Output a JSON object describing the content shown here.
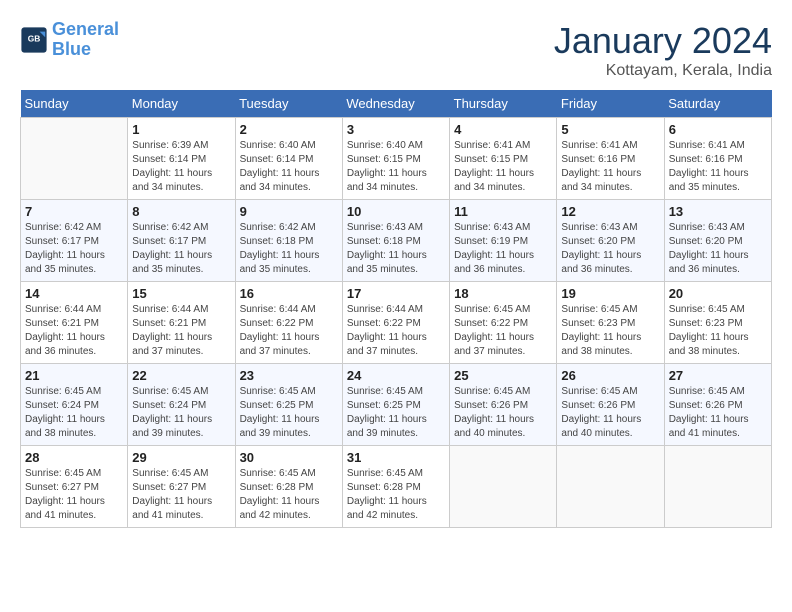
{
  "header": {
    "logo_line1": "General",
    "logo_line2": "Blue",
    "month": "January 2024",
    "location": "Kottayam, Kerala, India"
  },
  "weekdays": [
    "Sunday",
    "Monday",
    "Tuesday",
    "Wednesday",
    "Thursday",
    "Friday",
    "Saturday"
  ],
  "weeks": [
    [
      {
        "day": "",
        "sunrise": "",
        "sunset": "",
        "daylight": ""
      },
      {
        "day": "1",
        "sunrise": "Sunrise: 6:39 AM",
        "sunset": "Sunset: 6:14 PM",
        "daylight": "Daylight: 11 hours and 34 minutes."
      },
      {
        "day": "2",
        "sunrise": "Sunrise: 6:40 AM",
        "sunset": "Sunset: 6:14 PM",
        "daylight": "Daylight: 11 hours and 34 minutes."
      },
      {
        "day": "3",
        "sunrise": "Sunrise: 6:40 AM",
        "sunset": "Sunset: 6:15 PM",
        "daylight": "Daylight: 11 hours and 34 minutes."
      },
      {
        "day": "4",
        "sunrise": "Sunrise: 6:41 AM",
        "sunset": "Sunset: 6:15 PM",
        "daylight": "Daylight: 11 hours and 34 minutes."
      },
      {
        "day": "5",
        "sunrise": "Sunrise: 6:41 AM",
        "sunset": "Sunset: 6:16 PM",
        "daylight": "Daylight: 11 hours and 34 minutes."
      },
      {
        "day": "6",
        "sunrise": "Sunrise: 6:41 AM",
        "sunset": "Sunset: 6:16 PM",
        "daylight": "Daylight: 11 hours and 35 minutes."
      }
    ],
    [
      {
        "day": "7",
        "sunrise": "Sunrise: 6:42 AM",
        "sunset": "Sunset: 6:17 PM",
        "daylight": "Daylight: 11 hours and 35 minutes."
      },
      {
        "day": "8",
        "sunrise": "Sunrise: 6:42 AM",
        "sunset": "Sunset: 6:17 PM",
        "daylight": "Daylight: 11 hours and 35 minutes."
      },
      {
        "day": "9",
        "sunrise": "Sunrise: 6:42 AM",
        "sunset": "Sunset: 6:18 PM",
        "daylight": "Daylight: 11 hours and 35 minutes."
      },
      {
        "day": "10",
        "sunrise": "Sunrise: 6:43 AM",
        "sunset": "Sunset: 6:18 PM",
        "daylight": "Daylight: 11 hours and 35 minutes."
      },
      {
        "day": "11",
        "sunrise": "Sunrise: 6:43 AM",
        "sunset": "Sunset: 6:19 PM",
        "daylight": "Daylight: 11 hours and 36 minutes."
      },
      {
        "day": "12",
        "sunrise": "Sunrise: 6:43 AM",
        "sunset": "Sunset: 6:20 PM",
        "daylight": "Daylight: 11 hours and 36 minutes."
      },
      {
        "day": "13",
        "sunrise": "Sunrise: 6:43 AM",
        "sunset": "Sunset: 6:20 PM",
        "daylight": "Daylight: 11 hours and 36 minutes."
      }
    ],
    [
      {
        "day": "14",
        "sunrise": "Sunrise: 6:44 AM",
        "sunset": "Sunset: 6:21 PM",
        "daylight": "Daylight: 11 hours and 36 minutes."
      },
      {
        "day": "15",
        "sunrise": "Sunrise: 6:44 AM",
        "sunset": "Sunset: 6:21 PM",
        "daylight": "Daylight: 11 hours and 37 minutes."
      },
      {
        "day": "16",
        "sunrise": "Sunrise: 6:44 AM",
        "sunset": "Sunset: 6:22 PM",
        "daylight": "Daylight: 11 hours and 37 minutes."
      },
      {
        "day": "17",
        "sunrise": "Sunrise: 6:44 AM",
        "sunset": "Sunset: 6:22 PM",
        "daylight": "Daylight: 11 hours and 37 minutes."
      },
      {
        "day": "18",
        "sunrise": "Sunrise: 6:45 AM",
        "sunset": "Sunset: 6:22 PM",
        "daylight": "Daylight: 11 hours and 37 minutes."
      },
      {
        "day": "19",
        "sunrise": "Sunrise: 6:45 AM",
        "sunset": "Sunset: 6:23 PM",
        "daylight": "Daylight: 11 hours and 38 minutes."
      },
      {
        "day": "20",
        "sunrise": "Sunrise: 6:45 AM",
        "sunset": "Sunset: 6:23 PM",
        "daylight": "Daylight: 11 hours and 38 minutes."
      }
    ],
    [
      {
        "day": "21",
        "sunrise": "Sunrise: 6:45 AM",
        "sunset": "Sunset: 6:24 PM",
        "daylight": "Daylight: 11 hours and 38 minutes."
      },
      {
        "day": "22",
        "sunrise": "Sunrise: 6:45 AM",
        "sunset": "Sunset: 6:24 PM",
        "daylight": "Daylight: 11 hours and 39 minutes."
      },
      {
        "day": "23",
        "sunrise": "Sunrise: 6:45 AM",
        "sunset": "Sunset: 6:25 PM",
        "daylight": "Daylight: 11 hours and 39 minutes."
      },
      {
        "day": "24",
        "sunrise": "Sunrise: 6:45 AM",
        "sunset": "Sunset: 6:25 PM",
        "daylight": "Daylight: 11 hours and 39 minutes."
      },
      {
        "day": "25",
        "sunrise": "Sunrise: 6:45 AM",
        "sunset": "Sunset: 6:26 PM",
        "daylight": "Daylight: 11 hours and 40 minutes."
      },
      {
        "day": "26",
        "sunrise": "Sunrise: 6:45 AM",
        "sunset": "Sunset: 6:26 PM",
        "daylight": "Daylight: 11 hours and 40 minutes."
      },
      {
        "day": "27",
        "sunrise": "Sunrise: 6:45 AM",
        "sunset": "Sunset: 6:26 PM",
        "daylight": "Daylight: 11 hours and 41 minutes."
      }
    ],
    [
      {
        "day": "28",
        "sunrise": "Sunrise: 6:45 AM",
        "sunset": "Sunset: 6:27 PM",
        "daylight": "Daylight: 11 hours and 41 minutes."
      },
      {
        "day": "29",
        "sunrise": "Sunrise: 6:45 AM",
        "sunset": "Sunset: 6:27 PM",
        "daylight": "Daylight: 11 hours and 41 minutes."
      },
      {
        "day": "30",
        "sunrise": "Sunrise: 6:45 AM",
        "sunset": "Sunset: 6:28 PM",
        "daylight": "Daylight: 11 hours and 42 minutes."
      },
      {
        "day": "31",
        "sunrise": "Sunrise: 6:45 AM",
        "sunset": "Sunset: 6:28 PM",
        "daylight": "Daylight: 11 hours and 42 minutes."
      },
      {
        "day": "",
        "sunrise": "",
        "sunset": "",
        "daylight": ""
      },
      {
        "day": "",
        "sunrise": "",
        "sunset": "",
        "daylight": ""
      },
      {
        "day": "",
        "sunrise": "",
        "sunset": "",
        "daylight": ""
      }
    ]
  ]
}
